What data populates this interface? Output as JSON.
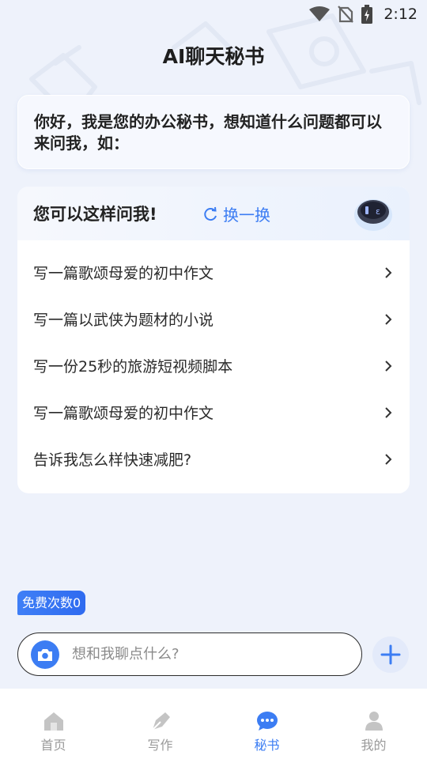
{
  "status_bar": {
    "time": "2:12",
    "icons": [
      "wifi-icon",
      "no-sim-icon",
      "battery-icon"
    ]
  },
  "header": {
    "title": "AI聊天秘书"
  },
  "greeting": {
    "text": "你好，我是您的办公秘书，想知道什么问题都可以 来问我，如："
  },
  "suggestions": {
    "title": "您可以这样问我!",
    "refresh_label": "换一换",
    "items": [
      "写一篇歌颂母爱的初中作文",
      "写一篇以武侠为题材的小说",
      "写一份25秒的旅游短视频脚本",
      "写一篇歌颂母爱的初中作文",
      "告诉我怎么样快速减肥?"
    ]
  },
  "composer": {
    "free_count_label": "免费次数0",
    "placeholder": "想和我聊点什么?"
  },
  "bottom_nav": {
    "items": [
      {
        "label": "首页",
        "icon": "home-icon",
        "active": false
      },
      {
        "label": "写作",
        "icon": "pen-icon",
        "active": false
      },
      {
        "label": "秘书",
        "icon": "chat-icon",
        "active": true
      },
      {
        "label": "我的",
        "icon": "user-icon",
        "active": false
      }
    ]
  },
  "colors": {
    "accent": "#3c7df3",
    "background": "#eef2fb",
    "inactive_nav": "#9a9a9a"
  }
}
